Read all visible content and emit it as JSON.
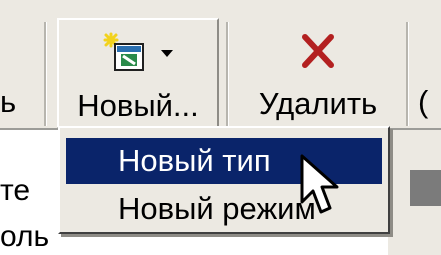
{
  "toolbar": {
    "prev_label": "ь",
    "new_label": "Новый...",
    "delete_label": "Удалить",
    "next_label": "(",
    "icons": {
      "new": "new-document-icon",
      "dropdown": "dropdown-arrow-icon",
      "delete": "delete-x-icon"
    },
    "colors": {
      "delete_x": "#b32020",
      "icon_green": "#2a8a4a",
      "star": "#f2d21c"
    }
  },
  "menu": {
    "items": [
      {
        "label": "Новый тип",
        "highlighted": true
      },
      {
        "label": "Новый режим",
        "highlighted": false
      }
    ],
    "highlight_color": "#0a246a"
  },
  "content": {
    "left_lines": [
      "те",
      "оль"
    ]
  }
}
